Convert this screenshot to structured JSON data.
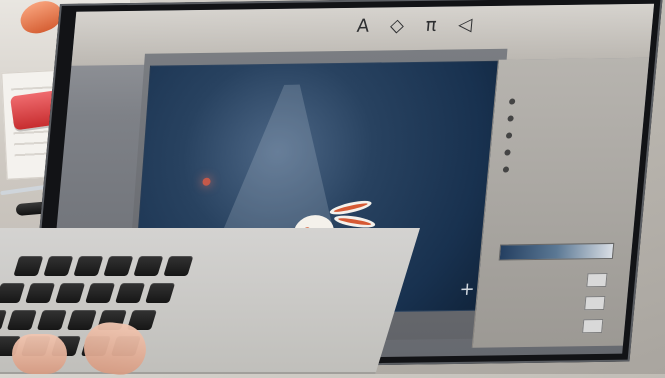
{
  "screen": {
    "ribbon_icons": [
      "text-icon",
      "shape-icon",
      "equation-icon",
      "sound-icon"
    ],
    "ribbon_labels": []
  },
  "panel": {
    "title": "",
    "rows": []
  },
  "slide": {
    "subject": "rabbit-illustration"
  },
  "colors": {
    "desk": "#cfcac3",
    "laptop_bezel": "#121316",
    "slide_bg": "#18314f",
    "rabbit_accent": "#d65a34",
    "panel_title": "#cf5f4d"
  }
}
